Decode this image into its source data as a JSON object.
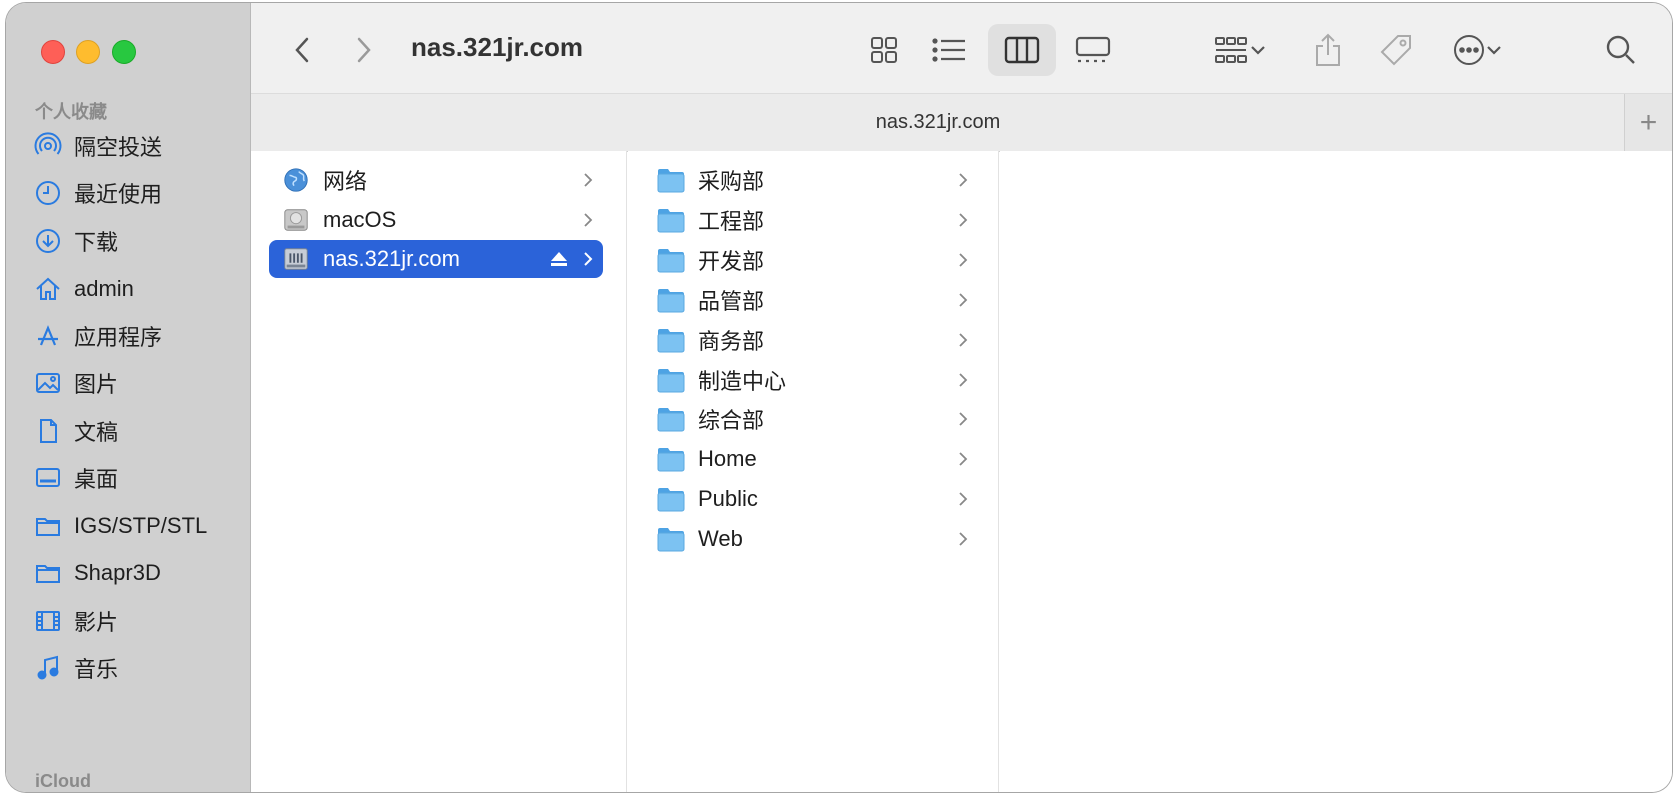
{
  "window_title": "nas.321jr.com",
  "tab_title": "nas.321jr.com",
  "tab_add": "+",
  "sidebar": {
    "favorites_heading": "个人收藏",
    "items": [
      {
        "label": "隔空投送",
        "icon": "airdrop-icon"
      },
      {
        "label": "最近使用",
        "icon": "clock-icon"
      },
      {
        "label": "下载",
        "icon": "download-icon"
      },
      {
        "label": "admin",
        "icon": "home-icon"
      },
      {
        "label": "应用程序",
        "icon": "apps-icon"
      },
      {
        "label": "图片",
        "icon": "photo-icon"
      },
      {
        "label": "文稿",
        "icon": "document-icon"
      },
      {
        "label": "桌面",
        "icon": "desktop-icon"
      },
      {
        "label": "IGS/STP/STL",
        "icon": "folder-icon"
      },
      {
        "label": "Shapr3D",
        "icon": "folder-icon"
      },
      {
        "label": "影片",
        "icon": "film-icon"
      },
      {
        "label": "音乐",
        "icon": "music-icon"
      }
    ],
    "icloud_heading": "iCloud"
  },
  "locations": [
    {
      "label": "网络",
      "icon": "globe-icon",
      "selected": false
    },
    {
      "label": "macOS",
      "icon": "hard-drive-icon",
      "selected": false
    },
    {
      "label": "nas.321jr.com",
      "icon": "server-icon",
      "selected": true
    }
  ],
  "folders": [
    "采购部",
    "工程部",
    "开发部",
    "品管部",
    "商务部",
    "制造中心",
    "综合部",
    "Home",
    "Public",
    "Web"
  ],
  "colors": {
    "selection": "#2b63d9",
    "folder": "#6cb8ee",
    "sidebar": "#d0d0d0",
    "sidebar_icon": "#2a7be0"
  }
}
